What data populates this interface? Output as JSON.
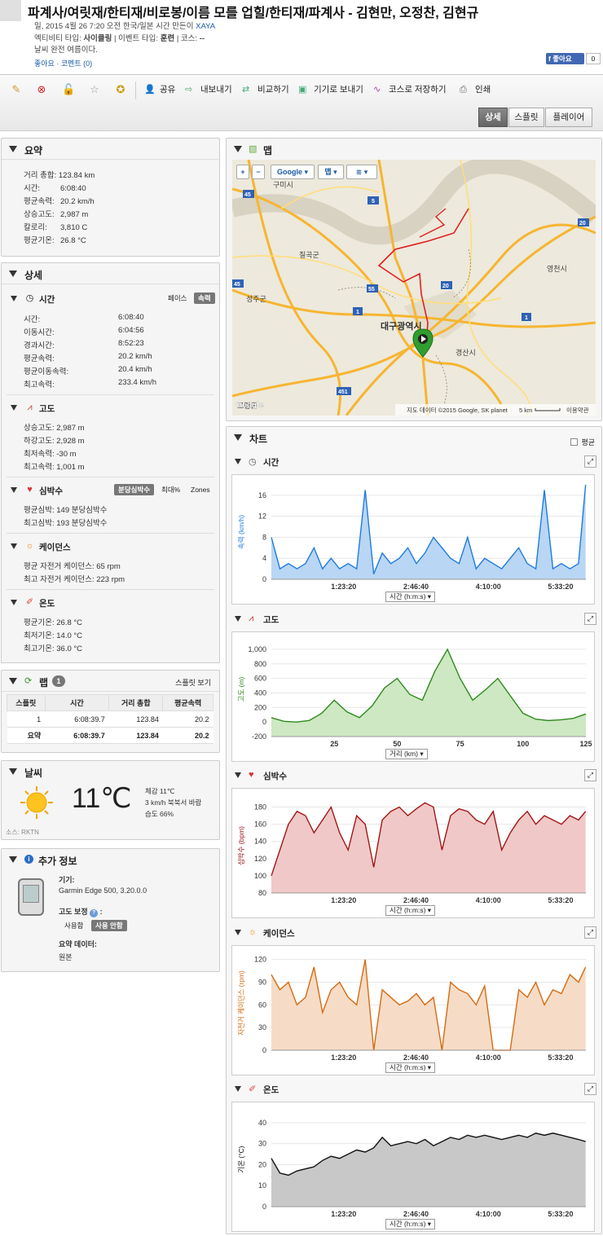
{
  "header": {
    "title": "파계사/여릿재/한티재/비로봉/이름 모를 업힐/한티재/파계사 - 김현만, 오정찬, 김현규",
    "line1": "일, 2015 4월 26 7:20 오전 한국/일본 시간 만든이 ",
    "author": "XAYA",
    "activity_label": "엑티비티 타입: ",
    "activity_value": "사이클링",
    "event_label": " | 이벤트 타입: ",
    "event_value": "훈련",
    "course_label": " | 코스: ",
    "course_value": "--",
    "weather_note": "날씨 완전 여름이다.",
    "like_link": "좋아요",
    "comment_link": "코멘트 (0)",
    "fb_like": "좋아요",
    "fb_count": "0"
  },
  "toolbar": {
    "share": "공유",
    "export": "내보내기",
    "compare": "비교하기",
    "send": "기기로 보내기",
    "save_course": "코스로 저장하기",
    "print": "인쇄",
    "view_detail": "상세",
    "view_splits": "스플릿",
    "view_player": "플레이어"
  },
  "summary": {
    "title": "요약",
    "rows": [
      {
        "k": "거리 총합:",
        "v": "123.84 km"
      },
      {
        "k": "시간:",
        "v": "6:08:40"
      },
      {
        "k": "평균속력:",
        "v": "20.2 km/h"
      },
      {
        "k": "상승고도:",
        "v": "2,987 m"
      },
      {
        "k": "칼로리:",
        "v": "3,810 C"
      },
      {
        "k": "평균기온:",
        "v": "26.8 °C"
      }
    ]
  },
  "details": {
    "title": "상세",
    "time": {
      "title": "시간",
      "pace": "페이스",
      "speed": "속력",
      "rows": [
        {
          "k": "시간:",
          "v": "6:08:40"
        },
        {
          "k": "이동시간:",
          "v": "6:04:56"
        },
        {
          "k": "경과시간:",
          "v": "8:52:23"
        },
        {
          "k": "평균속력:",
          "v": "20.2 km/h"
        },
        {
          "k": "평균이동속력:",
          "v": "20.4 km/h"
        },
        {
          "k": "최고속력:",
          "v": "233.4 km/h"
        }
      ]
    },
    "elev": {
      "title": "고도",
      "rows": [
        {
          "k": "상승고도:",
          "v": "2,987 m"
        },
        {
          "k": "하강고도:",
          "v": "2,928 m"
        },
        {
          "k": "최저속력:",
          "v": "-30 m"
        },
        {
          "k": "최고속력:",
          "v": "1,001 m"
        }
      ]
    },
    "hr": {
      "title": "심박수",
      "opt1": "분당심박수",
      "opt2": "최대%",
      "opt3": "Zones",
      "rows": [
        {
          "k": "평균심박:",
          "v": "149 분당심박수"
        },
        {
          "k": "최고심박:",
          "v": "193 분당심박수"
        }
      ]
    },
    "cad": {
      "title": "케이던스",
      "rows": [
        {
          "k": "평균 자전거 케이던스:",
          "v": "65 rpm"
        },
        {
          "k": "최고 자전거 케이던스:",
          "v": "223 rpm"
        }
      ]
    },
    "temp": {
      "title": "온도",
      "rows": [
        {
          "k": "평균기온:",
          "v": "26.8 °C"
        },
        {
          "k": "최저기온:",
          "v": "14.0 °C"
        },
        {
          "k": "최고기온:",
          "v": "36.0 °C"
        }
      ]
    }
  },
  "laps": {
    "title": "랩",
    "count": "1",
    "view_splits": "스플릿 보기",
    "headers": [
      "스플릿",
      "시간",
      "거리 총합",
      "평균속력"
    ],
    "rows": [
      [
        "1",
        "6:08:39.7",
        "123.84",
        "20.2"
      ],
      [
        "요약",
        "6:08:39.7",
        "123.84",
        "20.2"
      ]
    ]
  },
  "weather": {
    "title": "날씨",
    "temp": "11℃",
    "feels": "체감 11℃",
    "wind": "3 km/h 북북서 바람",
    "humidity": "습도 66%",
    "source": "소스: RKTN"
  },
  "extra": {
    "title": "추가 정보",
    "device_label": "기기:",
    "device": "Garmin Edge 500, 3.20.0.0",
    "elev_corr_label": "고도 보정",
    "opt_use": "사용함",
    "opt_nouse": "사용 안함",
    "summary_data_label": "요약 데이터:",
    "summary_data": "원본"
  },
  "map": {
    "title": "맵",
    "provider": "Google",
    "type": "맵",
    "attribution": "지도 데이터 ©2015 Google, SK planet",
    "scale": "5 km",
    "terms": "이용약관",
    "labels": [
      "구미시",
      "칠곡군",
      "성주군",
      "영천시",
      "대구광역시",
      "경산시",
      "고령군"
    ],
    "road_numbers": [
      "45",
      "5",
      "20",
      "55",
      "20",
      "1",
      "451",
      "45",
      "1"
    ]
  },
  "charts_panel": {
    "title": "차트",
    "avg": "평균"
  },
  "chart_data": [
    {
      "type": "area",
      "name": "시간",
      "ylabel": "속력 (km/h)",
      "xaxis_select": "시간 (h:m:s)",
      "ylim": [
        0,
        18
      ],
      "yticks": [
        "0",
        "4",
        "8",
        "12",
        "16"
      ],
      "xticks": [
        "1:23:20",
        "2:46:40",
        "4:10:00",
        "5:33:20"
      ],
      "xlim": [
        0,
        22120
      ],
      "color": "#1e7be0",
      "fill": "#b9d6f4",
      "x": [
        0,
        600,
        1200,
        1800,
        2400,
        3000,
        3600,
        4200,
        4800,
        5400,
        6000,
        6600,
        7200,
        7800,
        8400,
        9000,
        9600,
        10200,
        10800,
        11400,
        12000,
        12600,
        13200,
        13800,
        14400,
        15000,
        15600,
        16200,
        16800,
        17400,
        18000,
        18600,
        19200,
        19800,
        20400,
        21000,
        21600,
        22100
      ],
      "values": [
        8,
        2,
        3,
        2,
        3,
        6,
        2,
        4,
        2,
        3,
        2,
        17,
        1,
        5,
        3,
        4,
        6,
        3,
        5,
        8,
        6,
        4,
        3,
        8,
        2,
        4,
        3,
        2,
        4,
        6,
        3,
        2,
        17,
        2,
        3,
        2,
        3,
        18
      ]
    },
    {
      "type": "area",
      "name": "고도",
      "ylabel": "고도 (m)",
      "xaxis_select": "거리 (km)",
      "ylim": [
        -200,
        1100
      ],
      "yticks": [
        "-200",
        "0",
        "200",
        "400",
        "600",
        "800",
        "1,000"
      ],
      "xticks": [
        "25",
        "50",
        "75",
        "100",
        "125"
      ],
      "xlim": [
        0,
        125
      ],
      "color": "#2f8a1e",
      "fill": "#cde8c2",
      "x": [
        0,
        5,
        10,
        15,
        20,
        25,
        30,
        35,
        40,
        45,
        50,
        55,
        60,
        65,
        70,
        75,
        80,
        85,
        90,
        95,
        100,
        105,
        110,
        115,
        120,
        125
      ],
      "values": [
        60,
        10,
        0,
        20,
        120,
        300,
        140,
        60,
        220,
        470,
        600,
        380,
        300,
        700,
        1000,
        600,
        300,
        440,
        600,
        360,
        120,
        40,
        20,
        30,
        50,
        110
      ]
    },
    {
      "type": "area",
      "name": "심박수",
      "ylabel": "심박수 (bpm)",
      "xaxis_select": "시간 (h:m:s)",
      "ylim": [
        80,
        190
      ],
      "yticks": [
        "80",
        "100",
        "120",
        "140",
        "160",
        "180"
      ],
      "xticks": [
        "1:23:20",
        "2:46:40",
        "4:10:00",
        "5:33:20"
      ],
      "xlim": [
        0,
        22120
      ],
      "color": "#a31616",
      "fill": "#f0c8c8",
      "x": [
        0,
        600,
        1200,
        1800,
        2400,
        3000,
        3600,
        4200,
        4800,
        5400,
        6000,
        6600,
        7200,
        7800,
        8400,
        9000,
        9600,
        10200,
        10800,
        11400,
        12000,
        12600,
        13200,
        13800,
        14400,
        15000,
        15600,
        16200,
        16800,
        17400,
        18000,
        18600,
        19200,
        19800,
        20400,
        21000,
        21600,
        22100
      ],
      "values": [
        100,
        130,
        160,
        175,
        170,
        150,
        165,
        180,
        150,
        130,
        170,
        160,
        110,
        165,
        175,
        180,
        170,
        178,
        185,
        180,
        130,
        170,
        178,
        175,
        165,
        160,
        175,
        130,
        150,
        165,
        175,
        160,
        170,
        165,
        160,
        170,
        165,
        175
      ]
    },
    {
      "type": "area",
      "name": "케이던스",
      "ylabel": "자전거 케이던스 (rpm)",
      "xaxis_select": "시간 (h:m:s)",
      "ylim": [
        0,
        125
      ],
      "yticks": [
        "0",
        "30",
        "60",
        "90",
        "120"
      ],
      "xticks": [
        "1:23:20",
        "2:46:40",
        "4:10:00",
        "5:33:20"
      ],
      "xlim": [
        0,
        22120
      ],
      "color": "#d66a10",
      "fill": "#f6dcc6",
      "x": [
        0,
        600,
        1200,
        1800,
        2400,
        3000,
        3600,
        4200,
        4800,
        5400,
        6000,
        6600,
        7200,
        7800,
        8400,
        9000,
        9600,
        10200,
        10800,
        11400,
        12000,
        12600,
        13200,
        13800,
        14400,
        15000,
        15600,
        16200,
        16800,
        17400,
        18000,
        18600,
        19200,
        19800,
        20400,
        21000,
        21600,
        22100
      ],
      "values": [
        100,
        80,
        90,
        60,
        70,
        110,
        50,
        80,
        90,
        70,
        60,
        120,
        0,
        80,
        70,
        60,
        65,
        75,
        60,
        70,
        0,
        90,
        80,
        75,
        60,
        85,
        0,
        0,
        0,
        80,
        70,
        90,
        60,
        80,
        75,
        100,
        90,
        110
      ]
    },
    {
      "type": "area",
      "name": "온도",
      "ylabel": "기온 (°C)",
      "xaxis_select": "시간 (h:m:s)",
      "ylim": [
        0,
        45
      ],
      "yticks": [
        "0",
        "10",
        "20",
        "30",
        "40"
      ],
      "xticks": [
        "1:23:20",
        "2:46:40",
        "4:10:00",
        "5:33:20"
      ],
      "xlim": [
        0,
        22120
      ],
      "color": "#111111",
      "fill": "#c8c8c8",
      "x": [
        0,
        600,
        1200,
        1800,
        2400,
        3000,
        3600,
        4200,
        4800,
        5400,
        6000,
        6600,
        7200,
        7800,
        8400,
        9000,
        9600,
        10200,
        10800,
        11400,
        12000,
        12600,
        13200,
        13800,
        14400,
        15000,
        15600,
        16200,
        16800,
        17400,
        18000,
        18600,
        19200,
        19800,
        20400,
        21000,
        21600,
        22100
      ],
      "values": [
        23,
        16,
        15,
        17,
        18,
        19,
        22,
        24,
        23,
        25,
        27,
        26,
        28,
        33,
        29,
        30,
        31,
        30,
        32,
        29,
        31,
        33,
        32,
        34,
        33,
        34,
        33,
        32,
        33,
        34,
        33,
        35,
        34,
        35,
        34,
        33,
        32,
        31
      ]
    }
  ]
}
